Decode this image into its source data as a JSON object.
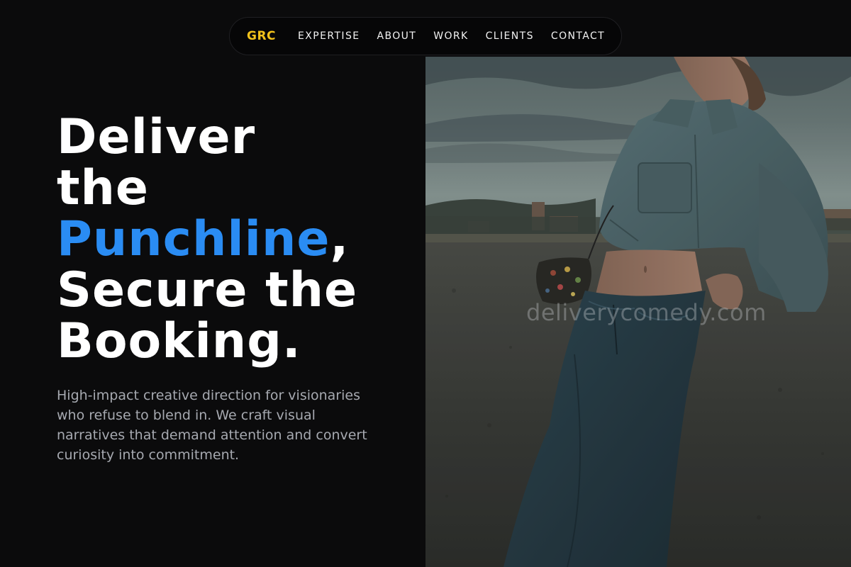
{
  "nav": {
    "brand": "GRC",
    "links": [
      "EXPERTISE",
      "ABOUT",
      "WORK",
      "CLIENTS",
      "CONTACT"
    ]
  },
  "hero": {
    "headline_line1": "Deliver",
    "headline_line2": "the",
    "headline_accent": "Punchline",
    "headline_comma": ",",
    "headline_line4": "Secure the",
    "headline_line5": "Booking.",
    "subcopy": "High-impact creative direction for visionaries who refuse to blend in. We craft visual narratives that demand attention and convert curiosity into commitment."
  },
  "image": {
    "watermark": "deliverycomedy.com",
    "subject": "woman in denim jacket and jeans leaning on a concrete wall at dusk"
  },
  "colors": {
    "background": "#0b0b0c",
    "brand": "#f2c21b",
    "accent": "#2a8cf3",
    "subtext": "#a6a9b0"
  }
}
